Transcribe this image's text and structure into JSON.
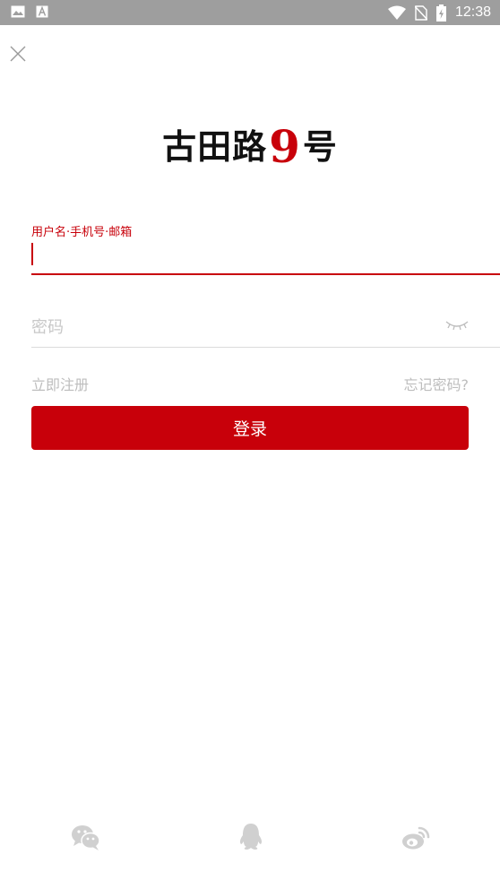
{
  "status_bar": {
    "time": "12:38",
    "icons": [
      "image-icon",
      "text-a-icon",
      "wifi-icon",
      "no-sim-icon",
      "battery-charging-icon"
    ]
  },
  "header": {
    "close_icon": "close-icon"
  },
  "logo": {
    "part1": "古田路",
    "part2": "9",
    "part3": "号",
    "accent_color": "#c8000a"
  },
  "form": {
    "username_label": "用户名·手机号·邮箱",
    "username_value": "",
    "password_placeholder": "密码",
    "password_value": "",
    "password_toggle_icon": "eye-closed-icon",
    "register_link": "立即注册",
    "forgot_link": "忘记密码?",
    "login_button": "登录"
  },
  "social_login": {
    "items": [
      "wechat-icon",
      "qq-icon",
      "weibo-icon"
    ]
  },
  "colors": {
    "accent": "#c8000a",
    "status_bar": "#9e9e9e",
    "muted_text": "#bdbdbd",
    "social_icon": "#d0d0d0"
  }
}
